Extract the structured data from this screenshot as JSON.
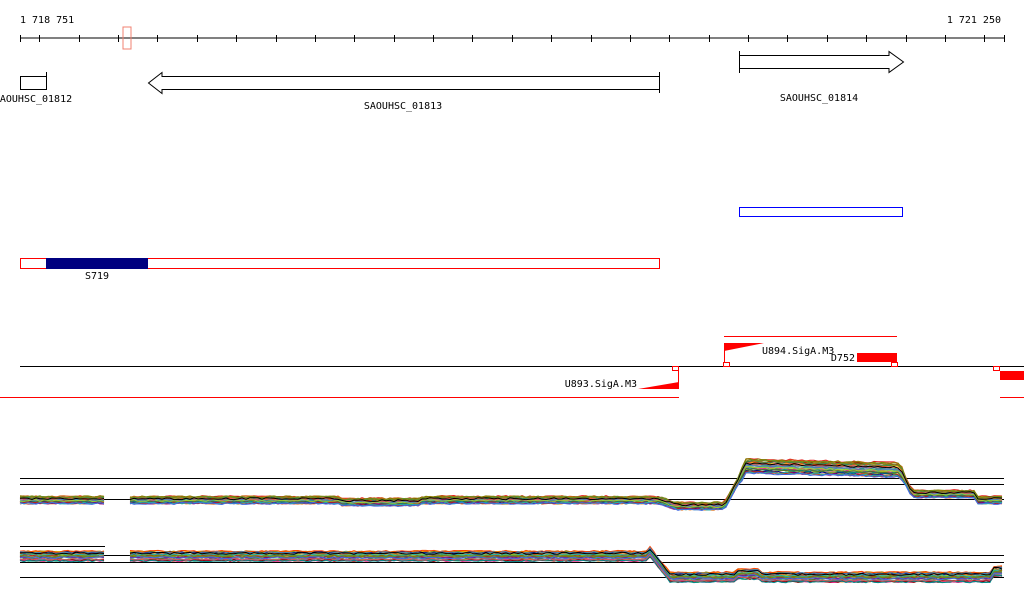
{
  "ruler": {
    "start_label": "1 718 751",
    "end_label": "1 721 250",
    "start": 1718751,
    "end": 1721250,
    "tick_step": 100
  },
  "genes": [
    {
      "label": "AOUHSC_01812",
      "strand": "none"
    },
    {
      "label": "SAOUHSC_01813",
      "strand": "minus"
    },
    {
      "label": "SAOUHSC_01814",
      "strand": "plus"
    }
  ],
  "features": {
    "segment_label": "S719",
    "promoter_minus": "U893.SigA.M3",
    "promoter_plus": "U894.SigA.M3",
    "terminator": "D752"
  },
  "colors": {
    "feature_red": "#ff0000",
    "segment_navy": "#000080",
    "blue_box": "#0000ff",
    "ruler_marker": "#f08070"
  }
}
